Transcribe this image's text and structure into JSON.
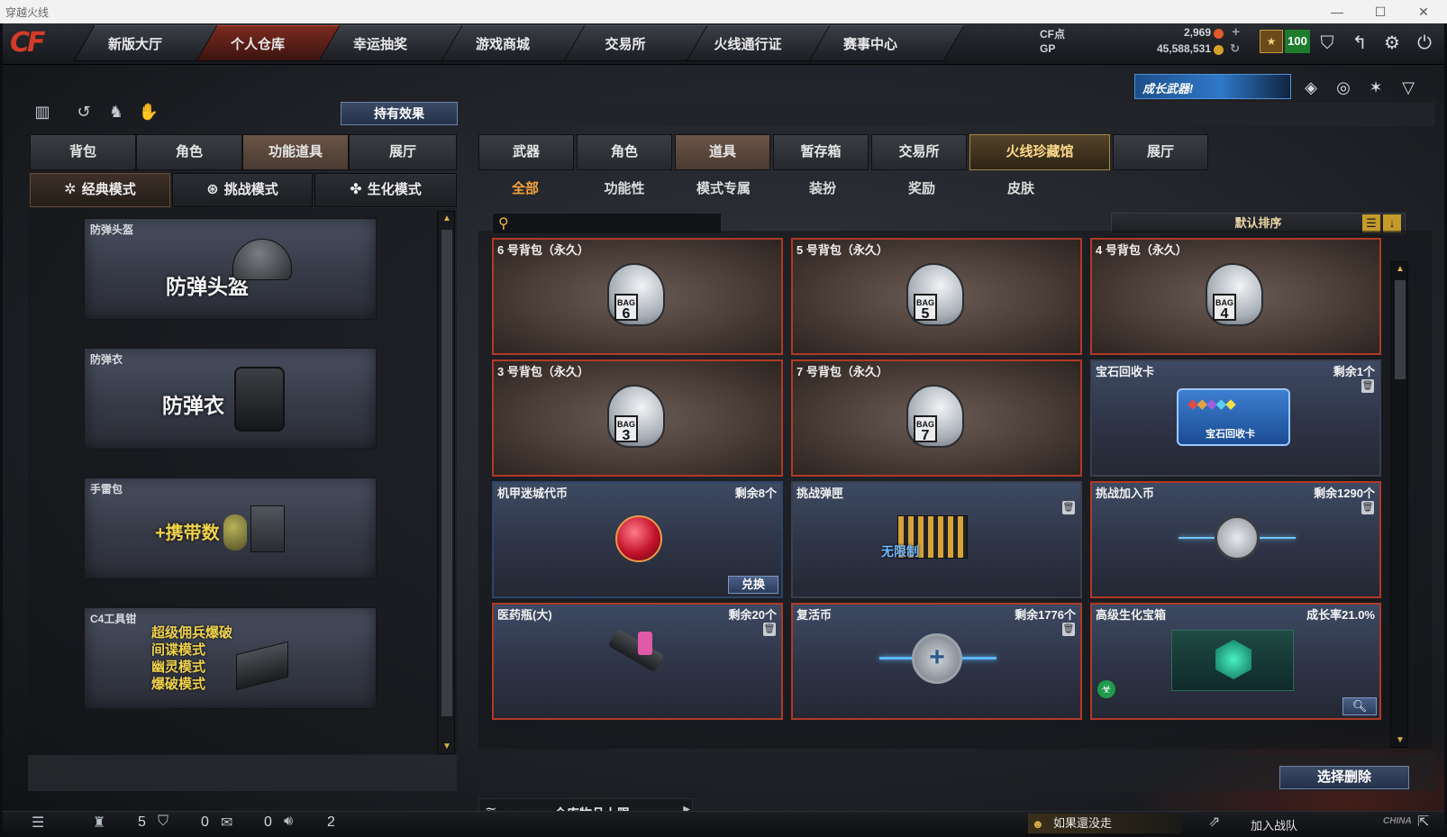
{
  "window": {
    "title": "穿越火线",
    "controls": [
      "—",
      "☐",
      "✕"
    ]
  },
  "logo": "CF",
  "nav": {
    "tabs": [
      {
        "label": "新版大厅"
      },
      {
        "label": "个人仓库",
        "active": true
      },
      {
        "label": "幸运抽奖"
      },
      {
        "label": "游戏商城"
      },
      {
        "label": "交易所"
      },
      {
        "label": "火线通行证"
      },
      {
        "label": "赛事中心"
      }
    ]
  },
  "currency": {
    "cf_label": "CF点",
    "cf_value": "2,969",
    "gp_label": "GP",
    "gp_value": "45,588,531",
    "level": "100"
  },
  "banner": {
    "text": "成长武器!"
  },
  "left": {
    "effect_button": "持有效果",
    "tabs": [
      "背包",
      "角色",
      "功能道具",
      "展厅"
    ],
    "active_tab": "功能道具",
    "modes": [
      "经典模式",
      "挑战模式",
      "生化模式"
    ],
    "cards": [
      {
        "label": "防弹头盔",
        "big": "防弹头盔"
      },
      {
        "label": "防弹衣",
        "big": "防弹衣"
      },
      {
        "label": "手雷包",
        "big": "+携带数"
      },
      {
        "label": "C4工具钳",
        "lines": [
          "超级佣兵爆破",
          "间谍模式",
          "幽灵模式",
          "爆破模式"
        ]
      }
    ]
  },
  "right": {
    "tabs": [
      "武器",
      "角色",
      "道具",
      "暂存箱",
      "交易所",
      "火线珍藏馆",
      "展厅"
    ],
    "active_tab": "道具",
    "subtabs": [
      "全部",
      "功能性",
      "模式专属",
      "装扮",
      "奖励",
      "皮肤"
    ],
    "active_subtab": "全部",
    "search_placeholder": "",
    "sort_label": "默认排序",
    "items": [
      {
        "name": "6 号背包（永久）",
        "bag": "6"
      },
      {
        "name": "5 号背包（永久）",
        "bag": "5"
      },
      {
        "name": "4 号背包（永久）",
        "bag": "4"
      },
      {
        "name": "3 号背包（永久）",
        "bag": "3"
      },
      {
        "name": "7 号背包（永久）",
        "bag": "7"
      },
      {
        "name": "宝石回收卡",
        "remain": "剩余1个",
        "art": "宝石回收卡"
      },
      {
        "name": "机甲迷城代币",
        "remain": "剩余8个",
        "action": "兑换"
      },
      {
        "name": "挑战弹匣",
        "art": "无限制"
      },
      {
        "name": "挑战加入币",
        "remain": "剩余1290个"
      },
      {
        "name": "医药瓶(大)",
        "remain": "剩余20个"
      },
      {
        "name": "复活币",
        "remain": "剩余1776个"
      },
      {
        "name": "高级生化宝箱",
        "remain": "成长率21.0%"
      }
    ],
    "delete_button": "选择删除",
    "capacity_label": "仓库物品上限"
  },
  "status": {
    "friends": "5",
    "clan": "0",
    "chat": "0",
    "volume": "2",
    "ticker": "如果還没走",
    "join": "加入战队",
    "china_tag": "CHINA"
  }
}
